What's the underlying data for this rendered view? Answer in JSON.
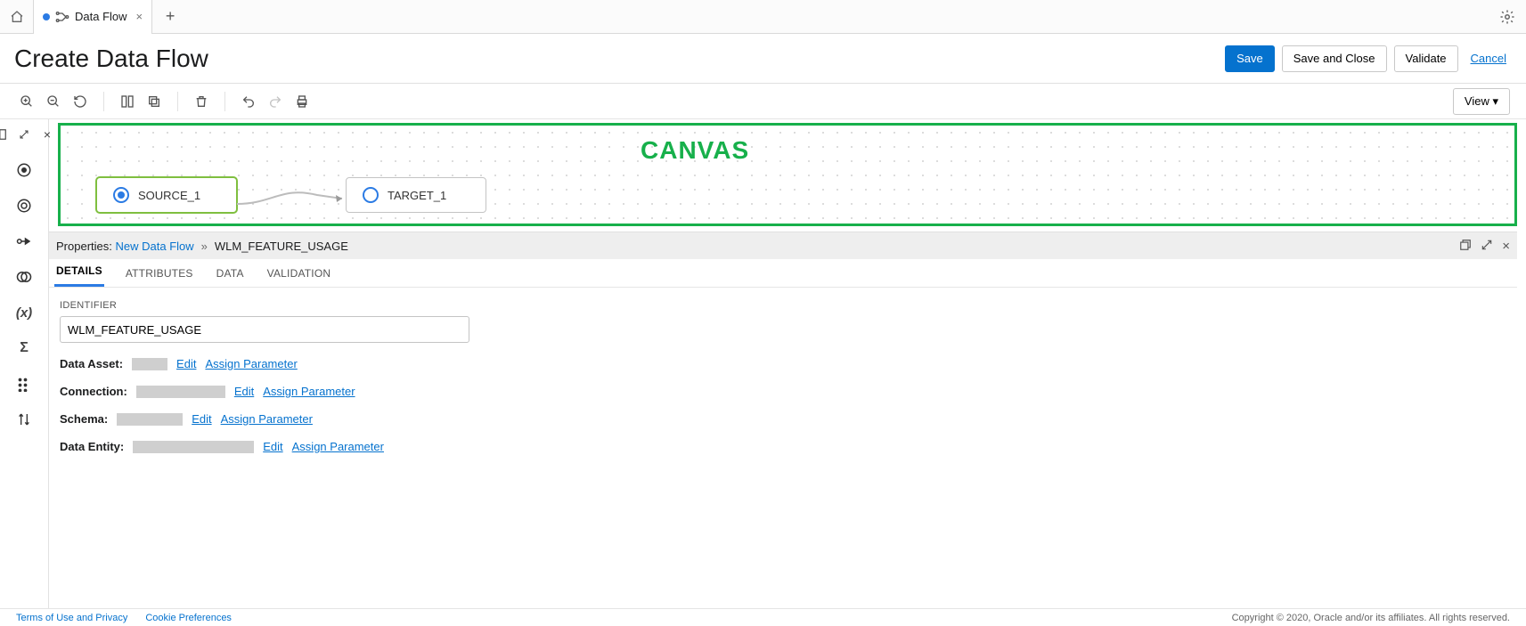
{
  "tabbar": {
    "active_tab_label": "Data Flow"
  },
  "header": {
    "title": "Create Data Flow",
    "save_label": "Save",
    "save_close_label": "Save and Close",
    "validate_label": "Validate",
    "cancel_label": "Cancel"
  },
  "toolbar": {
    "view_label": "View"
  },
  "canvas": {
    "label": "CANVAS",
    "source_node": "SOURCE_1",
    "target_node": "TARGET_1"
  },
  "properties": {
    "prefix": "Properties:",
    "breadcrumb_root": "New Data Flow",
    "breadcrumb_leaf": "WLM_FEATURE_USAGE",
    "tabs": {
      "details": "DETAILS",
      "attributes": "ATTRIBUTES",
      "data": "DATA",
      "validation": "VALIDATION"
    },
    "identifier_label": "IDENTIFIER",
    "identifier_value": "WLM_FEATURE_USAGE",
    "rows": {
      "data_asset": "Data Asset:",
      "connection": "Connection:",
      "schema": "Schema:",
      "data_entity": "Data Entity:"
    },
    "edit": "Edit",
    "assign": "Assign Parameter"
  },
  "footer": {
    "terms": "Terms of Use and Privacy",
    "cookie": "Cookie Preferences",
    "copyright": "Copyright © 2020, Oracle and/or its affiliates. All rights reserved."
  }
}
